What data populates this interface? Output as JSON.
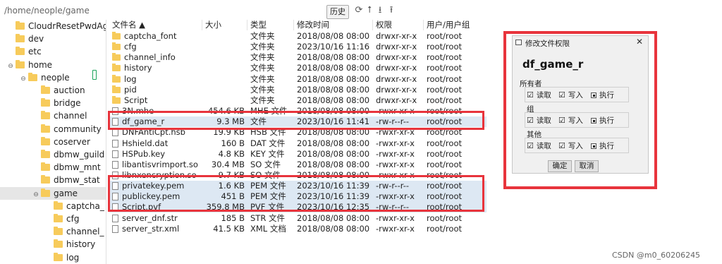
{
  "toolbar": {
    "path": "/home/neople/game",
    "history_label": "历史"
  },
  "tree": [
    {
      "label": "CloudrResetPwdAge",
      "indent": 0
    },
    {
      "label": "dev",
      "indent": 0
    },
    {
      "label": "etc",
      "indent": 0
    },
    {
      "label": "home",
      "indent": 0,
      "expanded": true
    },
    {
      "label": "neople",
      "indent": 1,
      "expanded": true
    },
    {
      "label": "auction",
      "indent": 2
    },
    {
      "label": "bridge",
      "indent": 2
    },
    {
      "label": "channel",
      "indent": 2
    },
    {
      "label": "community",
      "indent": 2
    },
    {
      "label": "coserver",
      "indent": 2
    },
    {
      "label": "dbmw_guild",
      "indent": 2
    },
    {
      "label": "dbmw_mnt",
      "indent": 2
    },
    {
      "label": "dbmw_stat",
      "indent": 2
    },
    {
      "label": "game",
      "indent": 2,
      "expanded": true,
      "selected": true
    },
    {
      "label": "captcha_",
      "indent": 3
    },
    {
      "label": "cfg",
      "indent": 3
    },
    {
      "label": "channel_",
      "indent": 3
    },
    {
      "label": "history",
      "indent": 3
    },
    {
      "label": "log",
      "indent": 3
    }
  ],
  "columns": {
    "name": "文件名 ▲",
    "size": "大小",
    "type": "类型",
    "modified": "修改时间",
    "perm": "权限",
    "owner": "用户/用户组"
  },
  "files": [
    {
      "name": "captcha_font",
      "size": "",
      "type": "文件夹",
      "modified": "2018/08/08 08:00",
      "perm": "drwxr-xr-x",
      "owner": "root/root",
      "dir": true
    },
    {
      "name": "cfg",
      "size": "",
      "type": "文件夹",
      "modified": "2023/10/16 11:16",
      "perm": "drwxr-xr-x",
      "owner": "root/root",
      "dir": true
    },
    {
      "name": "channel_info",
      "size": "",
      "type": "文件夹",
      "modified": "2018/08/08 08:00",
      "perm": "drwxr-xr-x",
      "owner": "root/root",
      "dir": true
    },
    {
      "name": "history",
      "size": "",
      "type": "文件夹",
      "modified": "2018/08/08 08:00",
      "perm": "drwxr-xr-x",
      "owner": "root/root",
      "dir": true
    },
    {
      "name": "log",
      "size": "",
      "type": "文件夹",
      "modified": "2018/08/08 08:00",
      "perm": "drwxr-xr-x",
      "owner": "root/root",
      "dir": true
    },
    {
      "name": "pid",
      "size": "",
      "type": "文件夹",
      "modified": "2018/08/08 08:00",
      "perm": "drwxr-xr-x",
      "owner": "root/root",
      "dir": true
    },
    {
      "name": "Script",
      "size": "",
      "type": "文件夹",
      "modified": "2018/08/08 08:00",
      "perm": "drwxr-xr-x",
      "owner": "root/root",
      "dir": true
    },
    {
      "name": "3N.mhe",
      "size": "454.6 KB",
      "type": "MHE 文件",
      "modified": "2018/08/08 08:00",
      "perm": "-rwxr-xr-x",
      "owner": "root/root"
    },
    {
      "name": "df_game_r",
      "size": "9.3 MB",
      "type": "文件",
      "modified": "2023/10/16 11:41",
      "perm": "-rw-r--r--",
      "owner": "root/root",
      "selected": true
    },
    {
      "name": "DNFAntiCpt.hsb",
      "size": "19.9 KB",
      "type": "HSB 文件",
      "modified": "2018/08/08 08:00",
      "perm": "-rwxr-xr-x",
      "owner": "root/root"
    },
    {
      "name": "Hshield.dat",
      "size": "160 B",
      "type": "DAT 文件",
      "modified": "2018/08/08 08:00",
      "perm": "-rwxr-xr-x",
      "owner": "root/root"
    },
    {
      "name": "HSPub.key",
      "size": "4.8 KB",
      "type": "KEY 文件",
      "modified": "2018/08/08 08:00",
      "perm": "-rwxr-xr-x",
      "owner": "root/root"
    },
    {
      "name": "libantisvrimport.so",
      "size": "30.4 MB",
      "type": "SO 文件",
      "modified": "2018/08/08 08:00",
      "perm": "-rwxr-xr-x",
      "owner": "root/root"
    },
    {
      "name": "libnxencryption.so",
      "size": "9.7 KB",
      "type": "SO 文件",
      "modified": "2018/08/08 08:00",
      "perm": "-rwxr-xr-x",
      "owner": "root/root"
    },
    {
      "name": "privatekey.pem",
      "size": "1.6 KB",
      "type": "PEM 文件",
      "modified": "2023/10/16 11:39",
      "perm": "-rw-r--r--",
      "owner": "root/root",
      "selected": true
    },
    {
      "name": "publickey.pem",
      "size": "451 B",
      "type": "PEM 文件",
      "modified": "2023/10/16 11:39",
      "perm": "-rwxr-xr-x",
      "owner": "root/root",
      "selected": true
    },
    {
      "name": "Script.pvf",
      "size": "359.8 MB",
      "type": "PVF 文件",
      "modified": "2023/10/16 12:35",
      "perm": "-rw-r--r--",
      "owner": "root/root",
      "selected": true
    },
    {
      "name": "server_dnf.str",
      "size": "185 B",
      "type": "STR 文件",
      "modified": "2018/08/08 08:00",
      "perm": "-rwxr-xr-x",
      "owner": "root/root"
    },
    {
      "name": "server_str.xml",
      "size": "41.5 KB",
      "type": "XML 文档",
      "modified": "2018/08/08 08:00",
      "perm": "-rwxr-xr-x",
      "owner": "root/root"
    }
  ],
  "dialog": {
    "title": "修改文件权限",
    "filename": "df_game_r",
    "groups": [
      {
        "label": "所有者",
        "read": "读取",
        "write": "写入",
        "exec": "执行"
      },
      {
        "label": "组",
        "read": "读取",
        "write": "写入",
        "exec": "执行"
      },
      {
        "label": "其他",
        "read": "读取",
        "write": "写入",
        "exec": "执行"
      }
    ],
    "ok": "确定",
    "cancel": "取消"
  },
  "watermark": "CSDN @m0_60206245"
}
